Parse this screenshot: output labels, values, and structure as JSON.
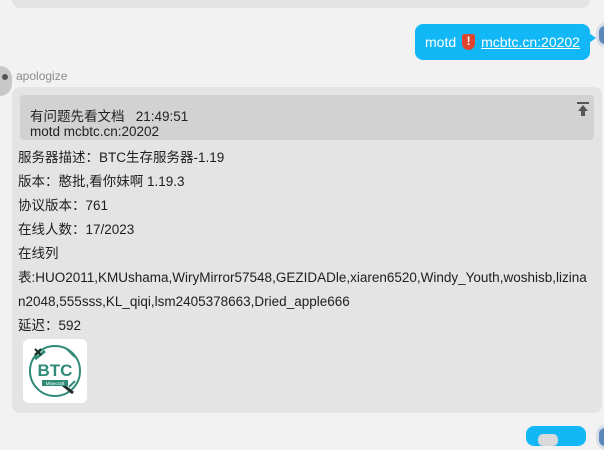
{
  "sent_message": {
    "prefix": "motd",
    "warning_icon": "exclamation-shield-icon",
    "link_text": "mcbtc.cn:20202"
  },
  "received_message": {
    "sender": "apologize",
    "quote": {
      "line1": "有问题先看文档   21:49:51",
      "line2": "motd mcbtc.cn:20202",
      "pin_icon": "pin-top-icon"
    },
    "lines": [
      "服务器描述：BTC生存服务器-1.19",
      "版本：憨批,看你妹啊 1.19.3",
      "协议版本：761",
      "在线人数：17/2023",
      "在线列",
      "表:HUO2011,KMUshama,WiryMirror57548,GEZIDADle,xiaren6520,Windy_Youth,woshisb,lizina",
      "n2048,555sss,KL_qiqi,lsm2405378663,Dried_apple666",
      "延迟：592"
    ],
    "image": {
      "logo_text": "BTC",
      "logo_subtext": "Minecraft"
    }
  },
  "colors": {
    "self_bubble": "#12b7f5",
    "other_bubble": "#e4e4e4",
    "quote_bg": "#d2d2d2",
    "background": "#f2f2f2",
    "logo_green": "#2f8a78"
  }
}
